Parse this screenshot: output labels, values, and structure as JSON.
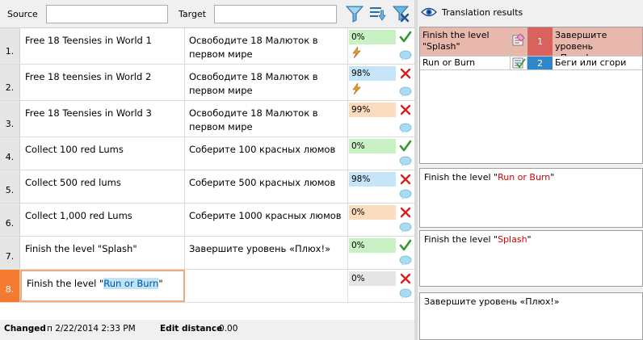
{
  "filter": {
    "source_label": "Source",
    "source_value": "",
    "target_label": "Target",
    "target_value": ""
  },
  "rows": [
    {
      "num": "1.",
      "source": "Free 18 Teensies in World 1",
      "target": "Освободите 18 Малюток в первом мире",
      "match": "0%",
      "match_color": "#c9f2c4",
      "status": "check",
      "flash": true
    },
    {
      "num": "2.",
      "source": "Free 18 teensies in World 2",
      "target": "Освободите 18 Малюток в первом мире",
      "match": "98%",
      "match_color": "#c6e5f8",
      "status": "x",
      "flash": true
    },
    {
      "num": "3.",
      "source": "Free 18 Teensies in World 3",
      "target": "Освободите 18 Малюток в первом мире",
      "match": "99%",
      "match_color": "#fbdcbf",
      "status": "x",
      "flash": false
    },
    {
      "num": "4.",
      "source": "Collect 100 red Lums",
      "target": "Соберите 100 красных люмов",
      "match": "0%",
      "match_color": "#c9f2c4",
      "status": "check",
      "flash": false
    },
    {
      "num": "5.",
      "source": "Collect 500 red lums",
      "target": "Соберите 500 красных люмов",
      "match": "98%",
      "match_color": "#c6e5f8",
      "status": "x",
      "flash": false
    },
    {
      "num": "6.",
      "source": "Collect 1,000 red Lums",
      "target": "Соберите 1000 красных люмов",
      "match": "0%",
      "match_color": "#fbdcbf",
      "status": "x",
      "flash": false
    },
    {
      "num": "7.",
      "source": "Finish the level \"Splash\"",
      "target": "Завершите уровень «Плюх!»",
      "match": "0%",
      "match_color": "#c9f2c4",
      "status": "check",
      "flash": false
    },
    {
      "num": "8.",
      "source_pre": "Finish the level \"",
      "source_hl": "Run or Burn",
      "source_post": "\"",
      "target": "",
      "match": "0%",
      "match_color": "#e6e6e6",
      "status": "x",
      "flash": false
    }
  ],
  "status": {
    "changed_label": "Changed",
    "changed_value": "п 2/22/2014 2:33 PM",
    "edit_distance_label": "Edit distance",
    "edit_distance_value": "0.00"
  },
  "results_panel": {
    "title": "Translation results",
    "items": [
      {
        "source": "Finish the level \"Splash\"",
        "num": "1",
        "num_color": "#d9625e",
        "target": "Завершите уровень «Плюх!",
        "truncated": "..."
      },
      {
        "source": "Run or Burn",
        "num": "2",
        "num_color": "#2f86c8",
        "target": "Беги или сгори"
      }
    ],
    "compare_box_1": {
      "pre": "Finish the level \"",
      "hl": "Run or Burn",
      "post": "\""
    },
    "compare_box_2": {
      "pre": "Finish the level \"",
      "hl": "Splash",
      "post": "\""
    },
    "target_box": "Завершите уровень «Плюх!»"
  },
  "icons": {
    "filter": "funnel-icon",
    "sort": "sort-list-icon",
    "clear": "clear-filter-icon",
    "eye": "eye-icon",
    "check": "green-check-icon",
    "x": "red-x-icon",
    "comment": "speech-bubble-icon",
    "flash": "lightning-icon"
  }
}
